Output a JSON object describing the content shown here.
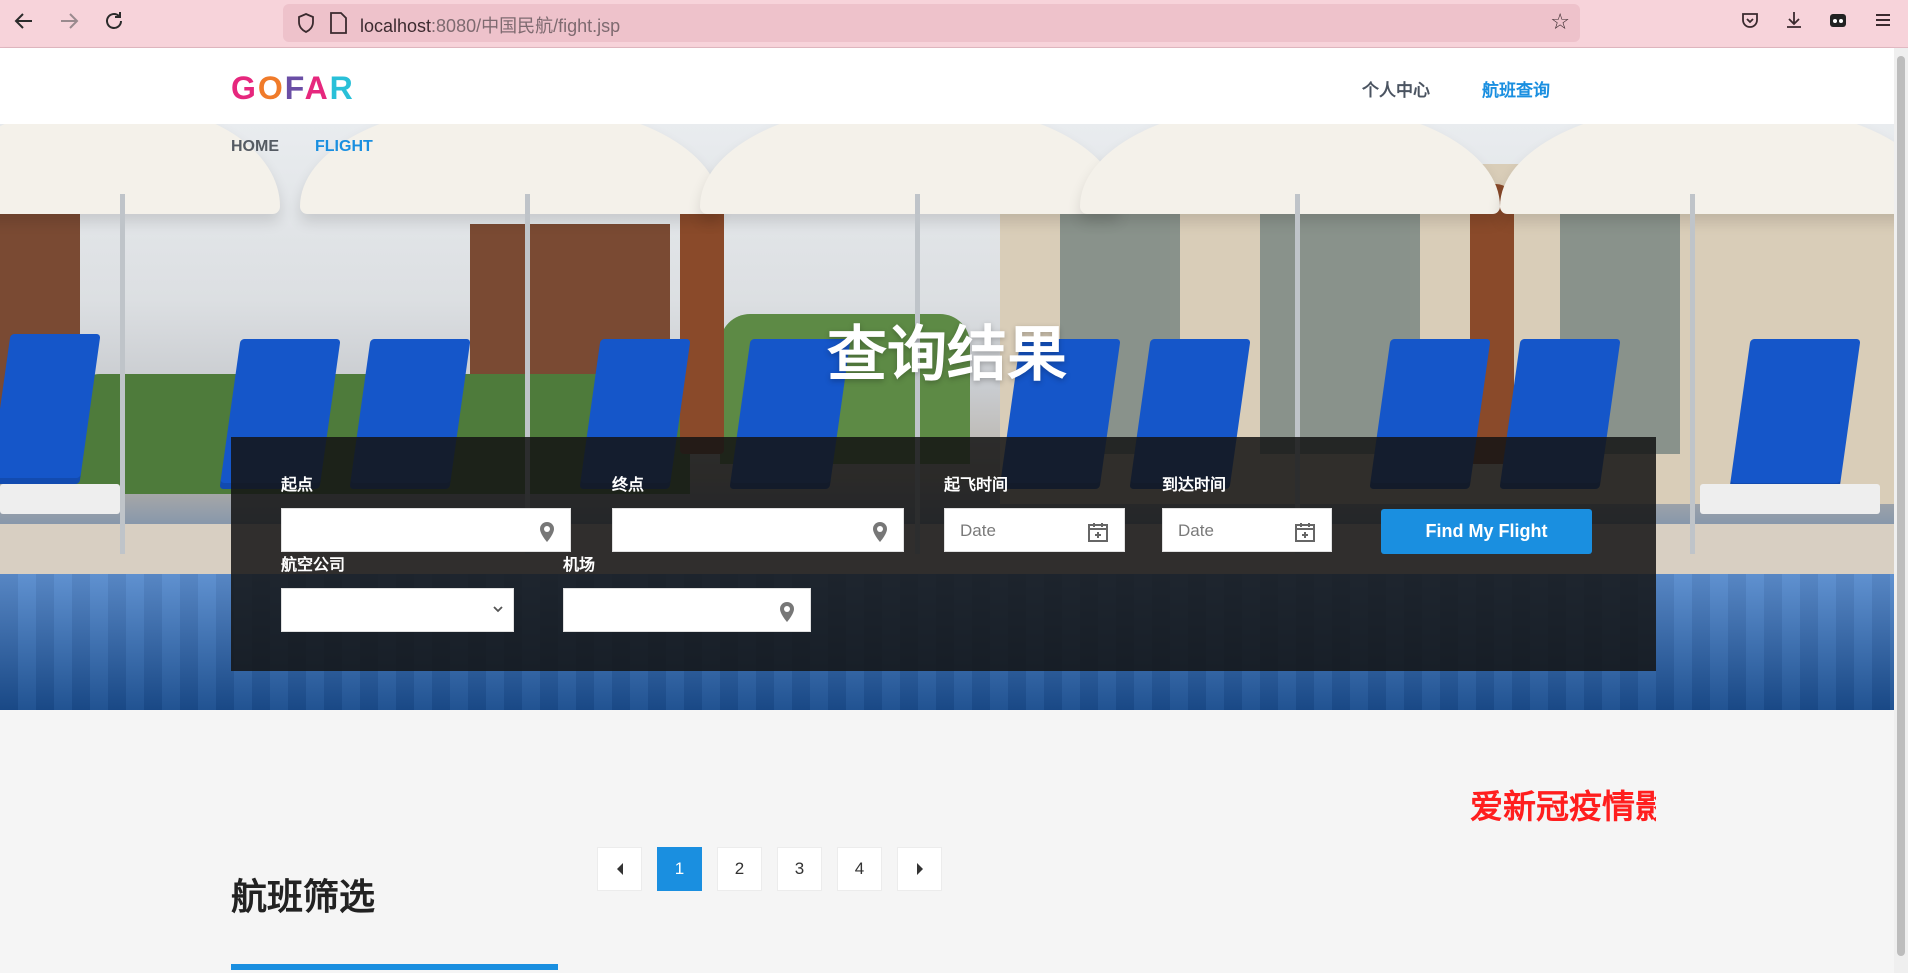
{
  "browser": {
    "url_host": "localhost",
    "url_rest": ":8080/中国民航/fight.jsp"
  },
  "header": {
    "logo": [
      "G",
      "O",
      "F",
      "A",
      "R"
    ],
    "nav": {
      "personal": "个人中心",
      "flight": "航班查询"
    }
  },
  "breadcrumb": {
    "home": "HOME",
    "flight": "FLIGHT"
  },
  "hero": {
    "title": "查询结果"
  },
  "search": {
    "origin_label": "起点",
    "destination_label": "终点",
    "depart_label": "起飞时间",
    "arrive_label": "到达时间",
    "depart_placeholder": "Date",
    "arrive_placeholder": "Date",
    "airline_label": "航空公司",
    "airport_label": "机场",
    "submit": "Find My Flight"
  },
  "notice": "爱新冠疫情影",
  "pagination": {
    "pages": [
      "1",
      "2",
      "3",
      "4"
    ],
    "active": "1"
  },
  "filter": {
    "title": "航班筛选"
  },
  "colors": {
    "accent": "#1a8fe0",
    "notice": "#ff1e1e",
    "browser_bar": "#f7d3da"
  }
}
